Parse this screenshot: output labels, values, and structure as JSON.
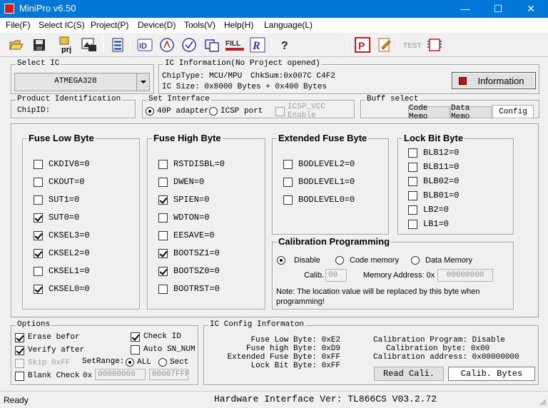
{
  "window": {
    "title": "MiniPro v6.50"
  },
  "menu": [
    "File(F)",
    "Select IC(S)",
    "Project(P)",
    "Device(D)",
    "Tools(V)",
    "Help(H)",
    "Language(L)"
  ],
  "toolbar": {
    "prj_label": "prj",
    "id_label": "ID",
    "fill_label": "FILL",
    "r_label": "R",
    "test_label": "TEST",
    "p_label": "P"
  },
  "select_ic": {
    "legend": "Select IC",
    "value": "ATMEGA328"
  },
  "ic_info": {
    "legend": "IC Information(No Project opened)",
    "chip_type": "ChipType:  MCU/MPU",
    "checksum": "ChkSum:0x007C C4F2",
    "ic_size": "IC Size:  0x8000 Bytes + 0x400 Bytes",
    "info_button": "Information"
  },
  "product_id": {
    "legend": "Product Identification",
    "chip_id": "ChipID:"
  },
  "set_interface": {
    "legend": "Set Interface",
    "opt_40p": "40P adapter",
    "opt_icsp": "ICSP port",
    "opt_vcc": "ICSP_VCC Enable"
  },
  "buff_select": {
    "legend": "Buff select",
    "tabs": [
      "Code Memo",
      "Data Memo",
      "Config"
    ]
  },
  "fuse_low": {
    "title": "Fuse Low Byte",
    "bits": [
      {
        "label": "CKDIV8=0",
        "checked": false
      },
      {
        "label": "CKOUT=0",
        "checked": false
      },
      {
        "label": "SUT1=0",
        "checked": false
      },
      {
        "label": "SUT0=0",
        "checked": true
      },
      {
        "label": "CKSEL3=0",
        "checked": true
      },
      {
        "label": "CKSEL2=0",
        "checked": true
      },
      {
        "label": "CKSEL1=0",
        "checked": false
      },
      {
        "label": "CKSEL0=0",
        "checked": true
      }
    ]
  },
  "fuse_high": {
    "title": "Fuse High Byte",
    "bits": [
      {
        "label": "RSTDISBL=0",
        "checked": false
      },
      {
        "label": "DWEN=0",
        "checked": false
      },
      {
        "label": "SPIEN=0",
        "checked": true
      },
      {
        "label": "WDTON=0",
        "checked": false
      },
      {
        "label": "EESAVE=0",
        "checked": false
      },
      {
        "label": "BOOTSZ1=0",
        "checked": true
      },
      {
        "label": "BOOTSZ0=0",
        "checked": true
      },
      {
        "label": "BOOTRST=0",
        "checked": false
      }
    ]
  },
  "fuse_ext": {
    "title": "Extended Fuse Byte",
    "bits": [
      {
        "label": "BODLEVEL2=0",
        "checked": false
      },
      {
        "label": "BODLEVEL1=0",
        "checked": false
      },
      {
        "label": "BODLEVEL0=0",
        "checked": false
      }
    ]
  },
  "lock_bits": {
    "title": "Lock Bit Byte",
    "bits": [
      {
        "label": "BLB12=0",
        "checked": false
      },
      {
        "label": "BLB11=0",
        "checked": false
      },
      {
        "label": "BLB02=0",
        "checked": false
      },
      {
        "label": "BLB01=0",
        "checked": false
      },
      {
        "label": "LB2=0",
        "checked": false
      },
      {
        "label": "LB1=0",
        "checked": false
      }
    ]
  },
  "calibration": {
    "title": "Calibration Programming",
    "opt_disable": "Disable",
    "opt_code": "Code memory",
    "opt_data": "Data Memory",
    "calib_label": "Calib.",
    "calib_value": "00",
    "addr_label": "Memory Address: 0x",
    "addr_value": "00000000",
    "note": "Note: The location value will be replaced by this byte  when programming!"
  },
  "options": {
    "legend": "Options",
    "erase": "Erase befor",
    "verify": "Verify after",
    "skip": "Skip 0xFF",
    "blank": "Blank Check",
    "check_id": "Check ID",
    "auto_sn": "Auto SN_NUM",
    "setrange": "SetRange:",
    "all": "ALL",
    "sect": "Sect",
    "hex_prefix": "0x",
    "range_start": "00000000",
    "arrow": "->",
    "range_end": "00007FFF"
  },
  "ic_config": {
    "legend": "IC Config Informaton",
    "fuse_low": "Fuse Low Byte: 0xE2",
    "fuse_high": "Fuse high Byte: 0xD9",
    "ext_fuse": "Extended Fuse Byte: 0xFF",
    "lock": "Lock Bit Byte: 0xFF",
    "cal_prog": "Calibration Program: Disable",
    "cal_byte": "Calibration byte: 0x00",
    "cal_addr": "Calibration address: 0x00000000",
    "read_cali": "Read Cali.",
    "calib_bytes": "Calib. Bytes"
  },
  "status": {
    "left": "Ready",
    "hardware": "Hardware Interface Ver: TL866CS V03.2.72"
  },
  "colors": {
    "titlebar": "#0078d7",
    "window_bg": "#f0f0f0",
    "info_button_accent": "#b01818"
  }
}
